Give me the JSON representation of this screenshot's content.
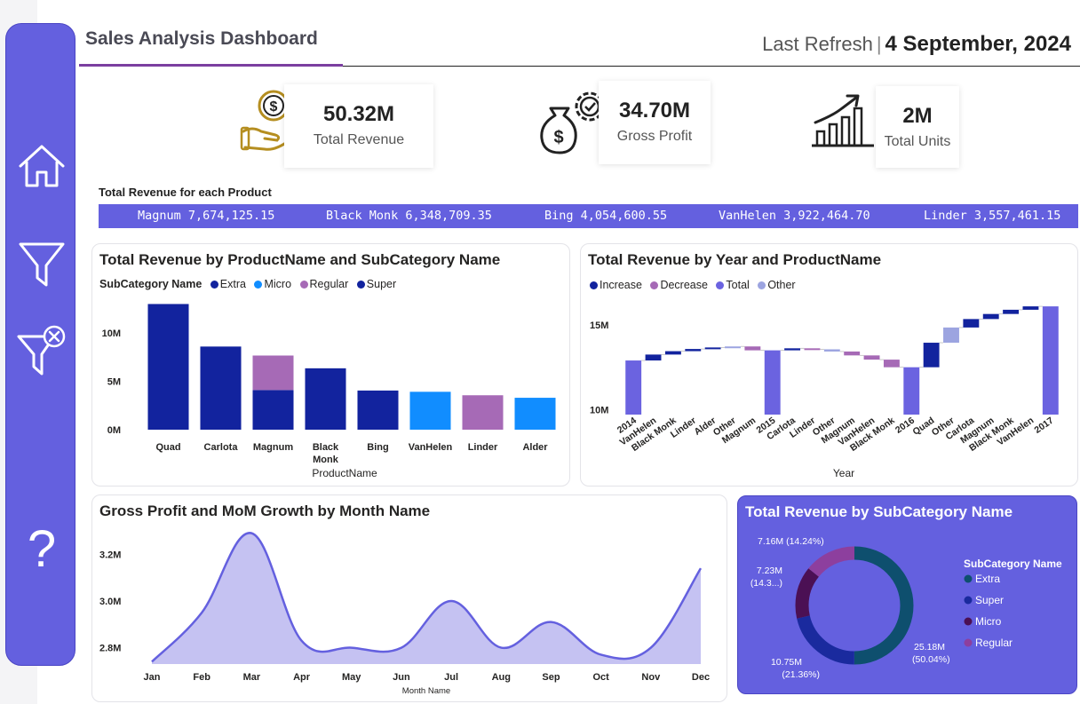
{
  "header": {
    "title": "Sales Analysis Dashboard",
    "refresh_label": "Last Refresh",
    "refresh_sep": "|",
    "refresh_date": "4 September, 2024"
  },
  "sidebar": {
    "items": [
      {
        "name": "home",
        "icon": "home-icon"
      },
      {
        "name": "filter",
        "icon": "filter-icon"
      },
      {
        "name": "clear-filter",
        "icon": "filter-clear-icon"
      },
      {
        "name": "help",
        "icon": "help-icon",
        "glyph": "?"
      }
    ]
  },
  "kpis": [
    {
      "value": "50.32M",
      "label": "Total Revenue",
      "icon": "money-hand-icon"
    },
    {
      "value": "34.70M",
      "label": "Gross Profit",
      "icon": "money-bag-gear-icon"
    },
    {
      "value": "2M",
      "label": "Total Units",
      "icon": "growth-chart-icon"
    }
  ],
  "ticker": {
    "title": "Total Revenue for each Product",
    "items": [
      "Magnum 7,674,125.15",
      "Black Monk 6,348,709.35",
      "Bing 4,054,600.55",
      "VanHelen 3,922,464.70",
      "Linder 3,557,461.15"
    ]
  },
  "colors": {
    "accent": "#6460df",
    "extra": "#12239e",
    "micro": "#118dff",
    "regular": "#a66ab6",
    "super": "#12239e",
    "increase": "#12239e",
    "decrease": "#a66ab6",
    "total": "#6b63e0",
    "other": "#9ca4e0",
    "area_line": "#6460df",
    "area_fill": "#c5c2f2",
    "donut_extra": "#0e4f6e",
    "donut_super": "#1a2a9e",
    "donut_micro": "#4b1054",
    "donut_regular": "#8d3f9e"
  },
  "chart_data": [
    {
      "id": "bar",
      "type": "bar",
      "title": "Total Revenue by ProductName and SubCategory Name",
      "legend_title": "SubCategory Name",
      "legend": [
        "Extra",
        "Micro",
        "Regular",
        "Super"
      ],
      "xlabel": "ProductName",
      "ylabel": "",
      "ylim": [
        0,
        13500000
      ],
      "yticks": [
        {
          "v": 0,
          "label": "0M"
        },
        {
          "v": 5000000,
          "label": "5M"
        },
        {
          "v": 10000000,
          "label": "10M"
        }
      ],
      "categories": [
        "Quad",
        "Carlota",
        "Magnum",
        "Black Monk",
        "Bing",
        "VanHelen",
        "Linder",
        "Alder"
      ],
      "category_lines": [
        [
          "Quad"
        ],
        [
          "Carlota"
        ],
        [
          "Magnum"
        ],
        [
          "Black",
          "Monk"
        ],
        [
          "Bing"
        ],
        [
          "VanHelen"
        ],
        [
          "Linder"
        ],
        [
          "Alder"
        ]
      ],
      "series": [
        {
          "name": "Super",
          "values": [
            13000000,
            8600000,
            4100000,
            6350000,
            4050000,
            0,
            0,
            0
          ]
        },
        {
          "name": "Regular",
          "values": [
            0,
            0,
            3570000,
            0,
            0,
            0,
            3560000,
            0
          ]
        },
        {
          "name": "Micro",
          "values": [
            0,
            0,
            0,
            0,
            0,
            3920000,
            0,
            3300000
          ]
        }
      ]
    },
    {
      "id": "waterfall",
      "type": "bar",
      "subtype": "waterfall",
      "title": "Total Revenue by Year and ProductName",
      "legend": [
        "Increase",
        "Decrease",
        "Total",
        "Other"
      ],
      "xlabel": "Year",
      "ylim": [
        9700000,
        16000000
      ],
      "yticks": [
        {
          "v": 10000000,
          "label": "10M"
        },
        {
          "v": 15000000,
          "label": "15M"
        }
      ],
      "bars": [
        {
          "label": "2014",
          "kind": "total",
          "start": 9700000,
          "end": 12900000
        },
        {
          "label": "VanHelen",
          "kind": "increase",
          "start": 12900000,
          "end": 13250000
        },
        {
          "label": "Black Monk",
          "kind": "increase",
          "start": 13250000,
          "end": 13450000
        },
        {
          "label": "Linder",
          "kind": "increase",
          "start": 13450000,
          "end": 13580000
        },
        {
          "label": "Alder",
          "kind": "increase",
          "start": 13580000,
          "end": 13670000
        },
        {
          "label": "Other",
          "kind": "other",
          "start": 13670000,
          "end": 13730000
        },
        {
          "label": "Magnum",
          "kind": "decrease",
          "start": 13730000,
          "end": 13500000
        },
        {
          "label": "2015",
          "kind": "total",
          "start": 9700000,
          "end": 13500000
        },
        {
          "label": "Carlota",
          "kind": "increase",
          "start": 13500000,
          "end": 13620000
        },
        {
          "label": "Linder",
          "kind": "decrease",
          "start": 13620000,
          "end": 13560000
        },
        {
          "label": "Other",
          "kind": "other",
          "start": 13560000,
          "end": 13430000
        },
        {
          "label": "Magnum",
          "kind": "decrease",
          "start": 13430000,
          "end": 13200000
        },
        {
          "label": "VanHelen",
          "kind": "decrease",
          "start": 13200000,
          "end": 12950000
        },
        {
          "label": "Black Monk",
          "kind": "decrease",
          "start": 12950000,
          "end": 12500000
        },
        {
          "label": "2016",
          "kind": "total",
          "start": 9700000,
          "end": 12500000
        },
        {
          "label": "Quad",
          "kind": "increase",
          "start": 12500000,
          "end": 13950000
        },
        {
          "label": "Other",
          "kind": "other",
          "start": 13950000,
          "end": 14850000
        },
        {
          "label": "Carlota",
          "kind": "increase",
          "start": 14850000,
          "end": 15350000
        },
        {
          "label": "Magnum",
          "kind": "increase",
          "start": 15350000,
          "end": 15650000
        },
        {
          "label": "Black Monk",
          "kind": "increase",
          "start": 15650000,
          "end": 15900000
        },
        {
          "label": "VanHelen",
          "kind": "increase",
          "start": 15900000,
          "end": 16100000
        },
        {
          "label": "2017",
          "kind": "total",
          "start": 9700000,
          "end": 16100000
        }
      ]
    },
    {
      "id": "area",
      "type": "area",
      "title": "Gross Profit and MoM Growth by Month Name",
      "xlabel": "Month Name",
      "ylabel": "",
      "ylim": [
        2730000,
        3300000
      ],
      "yticks": [
        {
          "v": 2800000,
          "label": "2.8M"
        },
        {
          "v": 3000000,
          "label": "3.0M"
        },
        {
          "v": 3200000,
          "label": "3.2M"
        }
      ],
      "categories": [
        "Jan",
        "Feb",
        "Mar",
        "Apr",
        "May",
        "Jun",
        "Jul",
        "Aug",
        "Sep",
        "Oct",
        "Nov",
        "Dec"
      ],
      "values": [
        2740000,
        2950000,
        3290000,
        2830000,
        2800000,
        2800000,
        3000000,
        2800000,
        2910000,
        2770000,
        2800000,
        3140000
      ]
    },
    {
      "id": "donut",
      "type": "pie",
      "subtype": "donut",
      "title": "Total Revenue by SubCategory Name",
      "legend_title": "SubCategory Name",
      "slices": [
        {
          "name": "Extra",
          "value": 25180000,
          "label1": "25.18M",
          "label2": "(50.04%)"
        },
        {
          "name": "Super",
          "value": 10750000,
          "label1": "10.75M",
          "label2": "(21.36%)"
        },
        {
          "name": "Micro",
          "value": 7230000,
          "label1": "7.23M",
          "label2": "(14.3...)"
        },
        {
          "name": "Regular",
          "value": 7160000,
          "label1": "7.16M (14.24%)",
          "label2": ""
        }
      ]
    }
  ]
}
